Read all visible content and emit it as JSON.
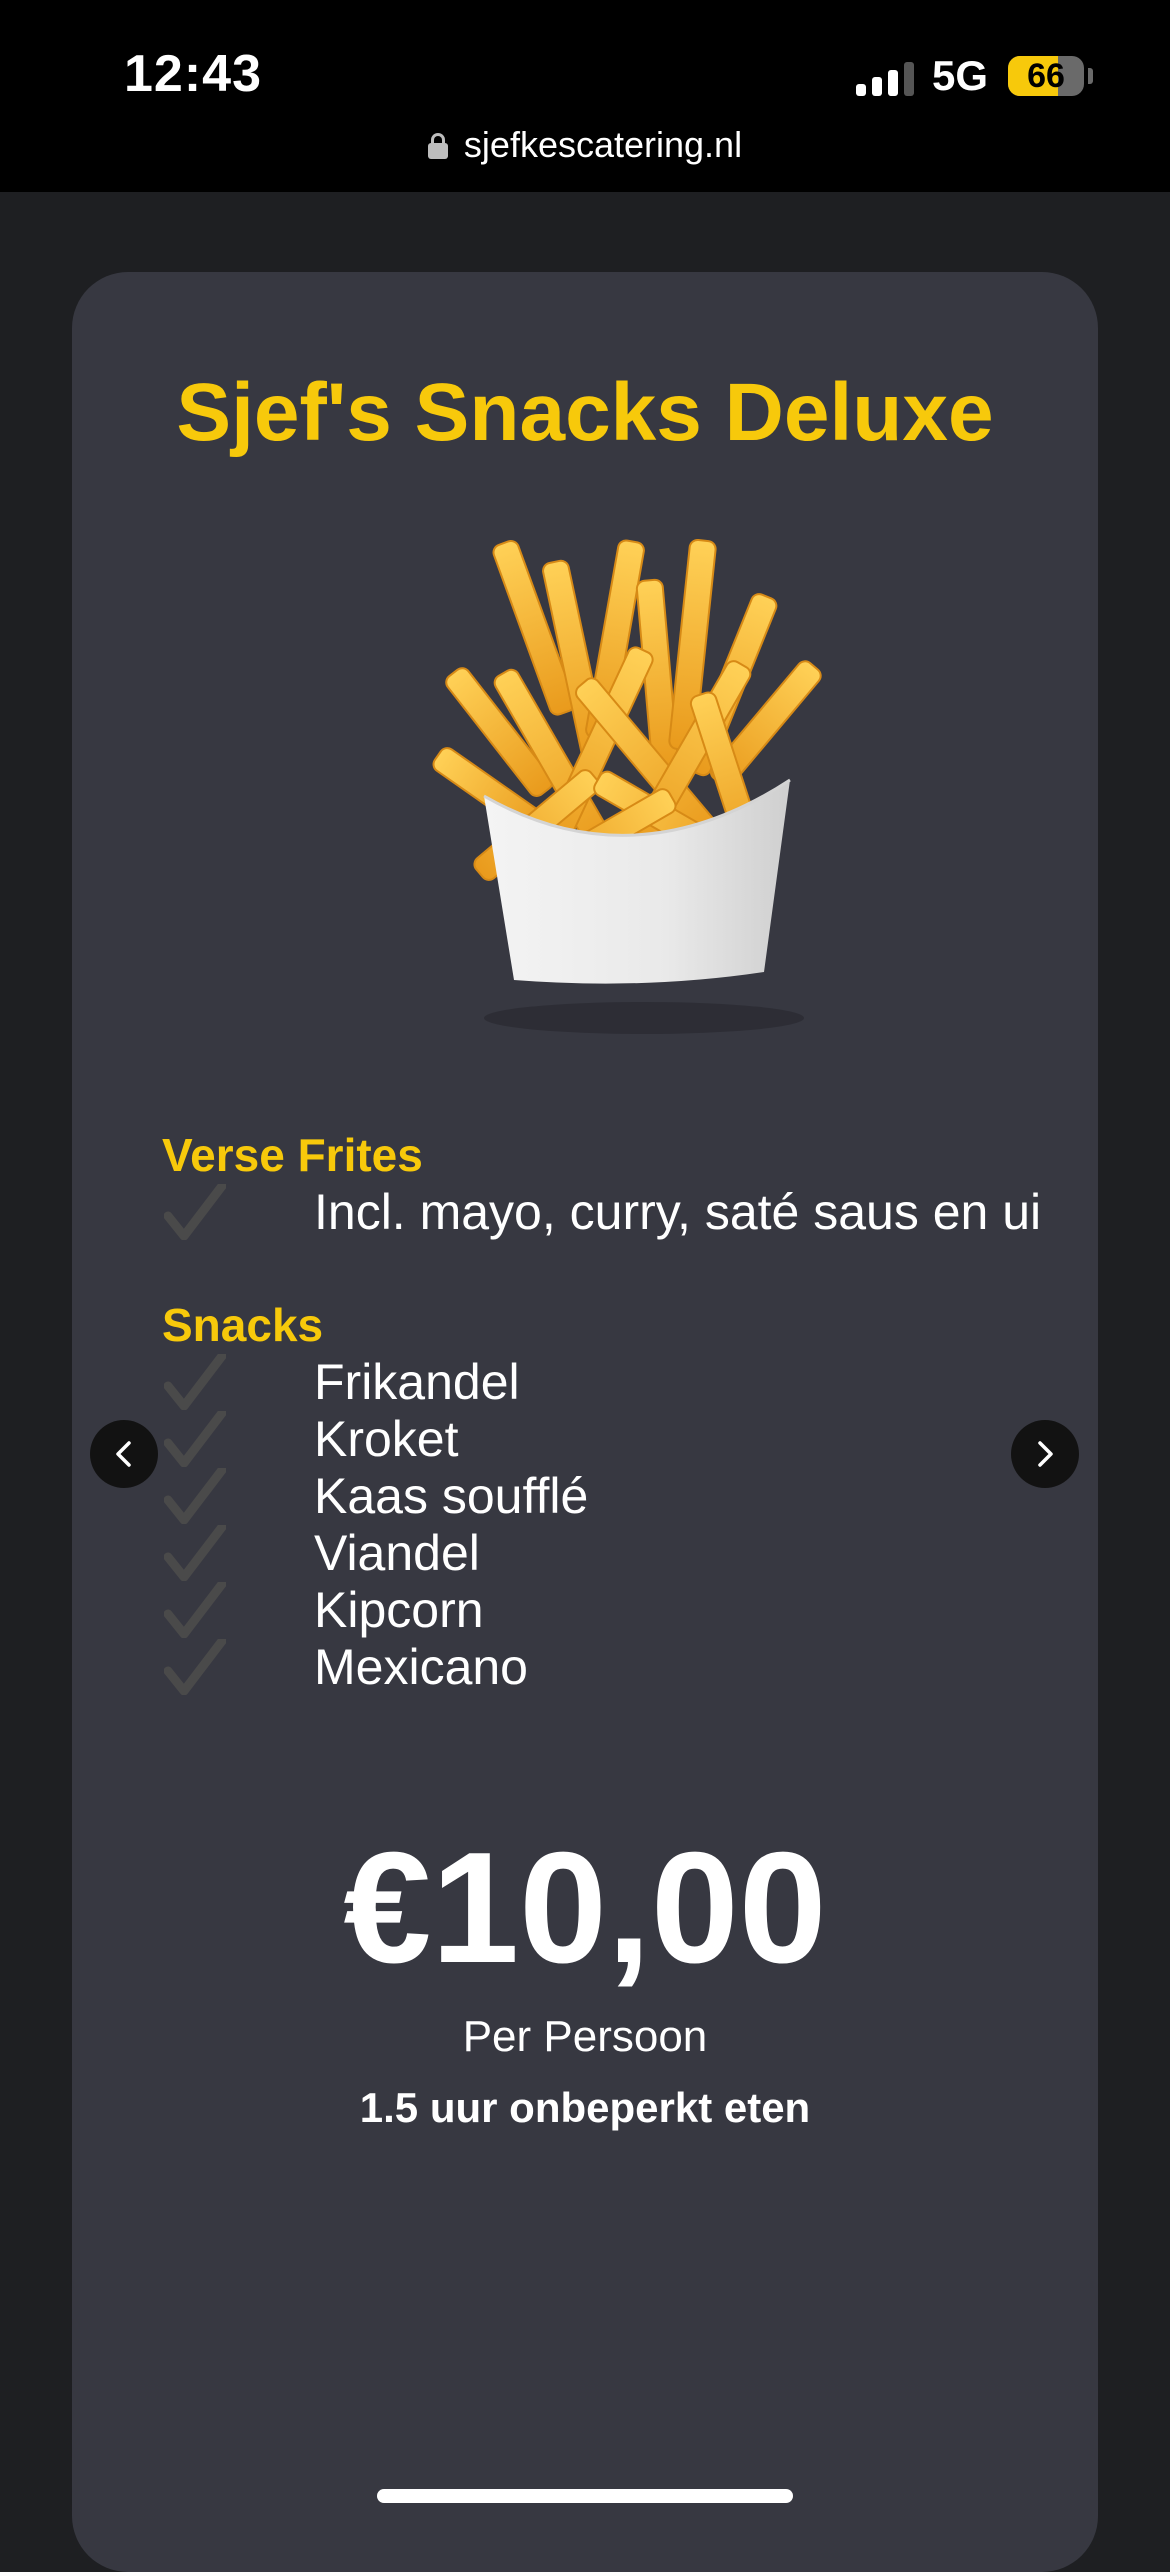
{
  "status_bar": {
    "time": "12:43",
    "network": "5G",
    "battery_level": "66",
    "battery_fraction": 0.66
  },
  "browser": {
    "url": "sjefkescatering.nl"
  },
  "card": {
    "title": "Sjef's Snacks Deluxe",
    "image_alt": "fries-in-paper-carton",
    "sections": [
      {
        "title": "Verse Frites",
        "items": [
          "Incl. mayo, curry, saté saus en ui"
        ]
      },
      {
        "title": "Snacks",
        "items": [
          "Frikandel",
          "Kroket",
          "Kaas soufflé",
          "Viandel",
          "Kipcorn",
          "Mexicano"
        ]
      }
    ],
    "price": "€10,00",
    "price_unit": "Per Persoon",
    "duration": "1.5 uur onbeperkt eten"
  },
  "icons": {
    "check": "check-icon",
    "prev": "chevron-left-icon",
    "next": "chevron-right-icon",
    "lock": "lock-icon"
  },
  "colors": {
    "accent": "#f7c90b",
    "card_background": "#373841",
    "page_background": "#1e1f22",
    "check_color": "#4a4a4a"
  }
}
